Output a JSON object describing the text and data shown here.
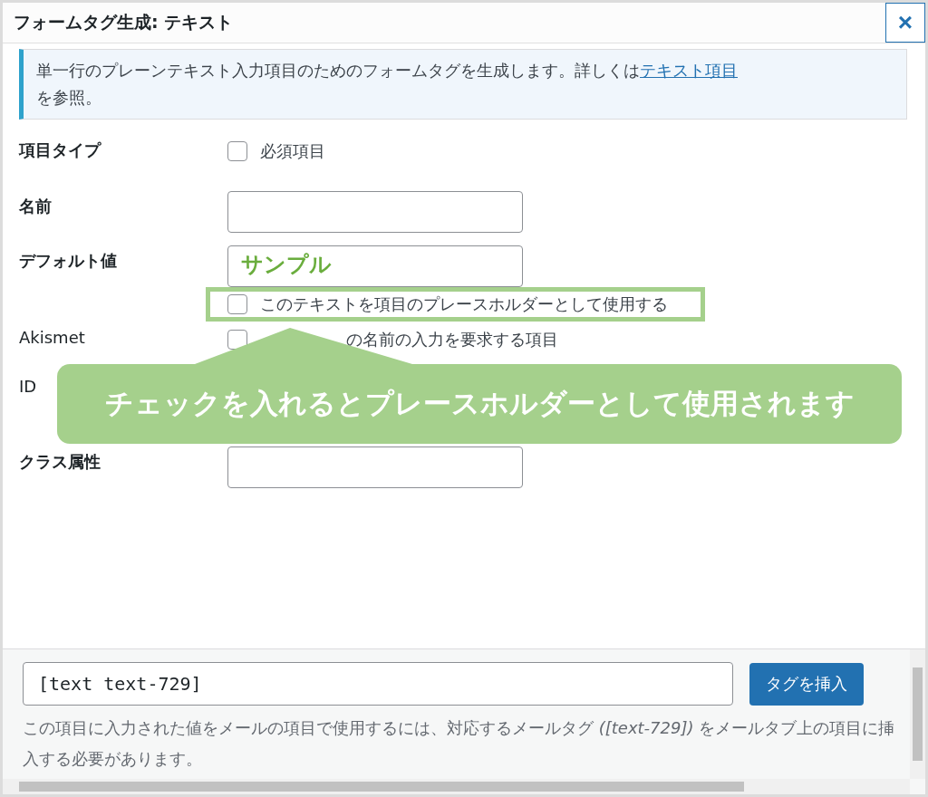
{
  "window": {
    "title": "フォームタグ生成: テキスト",
    "close": "×"
  },
  "notice": {
    "text": "単一行のプレーンテキスト入力項目のためのフォームタグを生成します。詳しくは",
    "link": "テキスト項目",
    "after": "を参照。"
  },
  "fields": [
    {
      "label": "項目タイプ",
      "kind": "checkbox",
      "option": {
        "label": "必須項目",
        "checked": false
      }
    },
    {
      "label": "名前",
      "kind": "text"
    },
    {
      "label": "デフォルト値",
      "kind": "text",
      "value": "サンプル",
      "option": {
        "label": "このテキストを項目のプレースホルダーとして使用する",
        "checked": false,
        "highlighted": true
      }
    },
    {
      "label": "Akismet",
      "kind": "checkbox",
      "option": {
        "label": "の名前の入力を要求する項目",
        "checked": false
      }
    },
    {
      "label": "ID",
      "kind": "label"
    },
    {
      "label": "クラス属性",
      "kind": "text"
    }
  ],
  "callout": {
    "text": "チェックを入れるとプレースホルダーとして使用されます"
  },
  "footer": {
    "tag": "[text text-729]",
    "button": "タグを挿入",
    "description": "この項目に入力された値をメールの項目で使用するには、対応するメールタグ *([text-729])* をメールタブ上の項目に挿入する必要があります。"
  }
}
